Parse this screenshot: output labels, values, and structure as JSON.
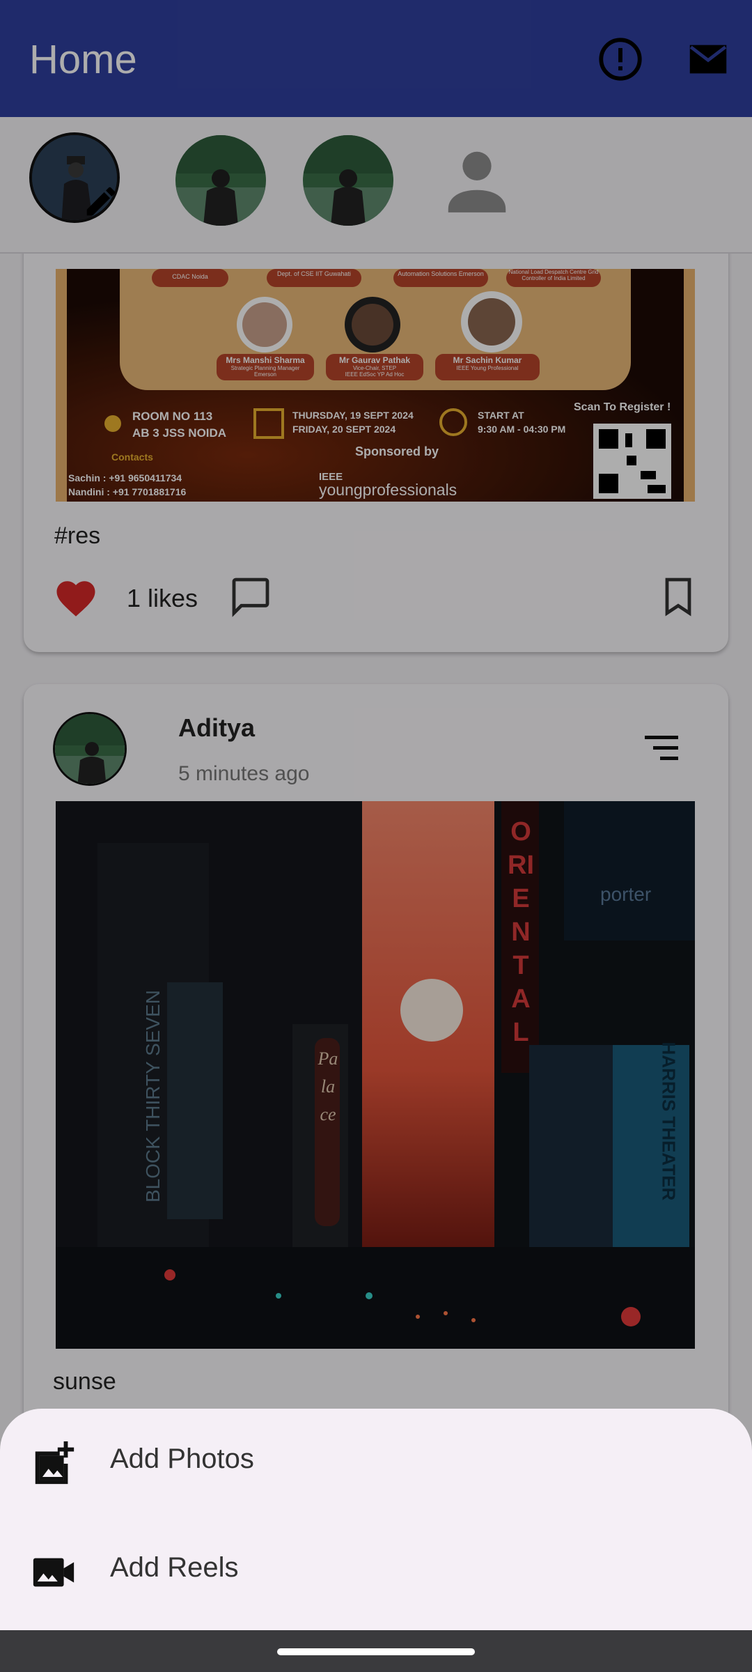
{
  "app_bar": {
    "title": "Home",
    "alert_icon": "alert-circle-icon",
    "mail_icon": "mail-icon",
    "color": "#2f3f9e"
  },
  "stories": [
    {
      "type": "own-story-edit"
    },
    {
      "type": "story"
    },
    {
      "type": "story"
    },
    {
      "type": "default-profile"
    }
  ],
  "poster": {
    "speakers_top": [
      "CDAC Noida",
      "Dept. of CSE IIT Guwahati",
      "Automation Solutions Emerson",
      "National Load Despatch Centre Grid Controller of India Limited"
    ],
    "speakers": [
      {
        "name": "Mrs Manshi Sharma",
        "role": "Strategic Planning Manager",
        "org": "Emerson"
      },
      {
        "name": "Mr Gaurav Pathak",
        "role": "Vice-Chair, STEP",
        "org": "IEEE EdSoc YP Ad Hoc"
      },
      {
        "name": "Mr Sachin Kumar",
        "role": "IEEE Young Professional",
        "org": ""
      }
    ],
    "venue_1": "ROOM NO 113",
    "venue_2": "AB 3 JSS NOIDA",
    "date_1": "THURSDAY, 19 SEPT 2024",
    "date_2": "FRIDAY, 20 SEPT 2024",
    "time_1": "START AT",
    "time_2": "9:30 AM - 04:30 PM",
    "register": "Scan To Register !",
    "sponsored": "Sponsored by",
    "contacts": "Contacts",
    "contact_1": "Sachin : +91 9650411734",
    "contact_2": "Nandini : +91 7701881716",
    "ieee": "IEEE",
    "yp": "youngprofessionals"
  },
  "post1": {
    "caption": "#res",
    "likes": "1 likes",
    "liked": true
  },
  "post2": {
    "author": "Aditya",
    "time": "5 minutes ago",
    "caption": "sunse",
    "sign_1": "ORIENTAL",
    "sign_2": "BLOCK THIRTY SEVEN",
    "sign_3": "Palace",
    "sign_4": "HARRIS THEATER",
    "sign_5": "porter"
  },
  "sheet": {
    "items": [
      {
        "label": "Add Photos",
        "icon": "add-photo-icon"
      },
      {
        "label": "Add Reels",
        "icon": "video-camera-icon"
      }
    ]
  }
}
